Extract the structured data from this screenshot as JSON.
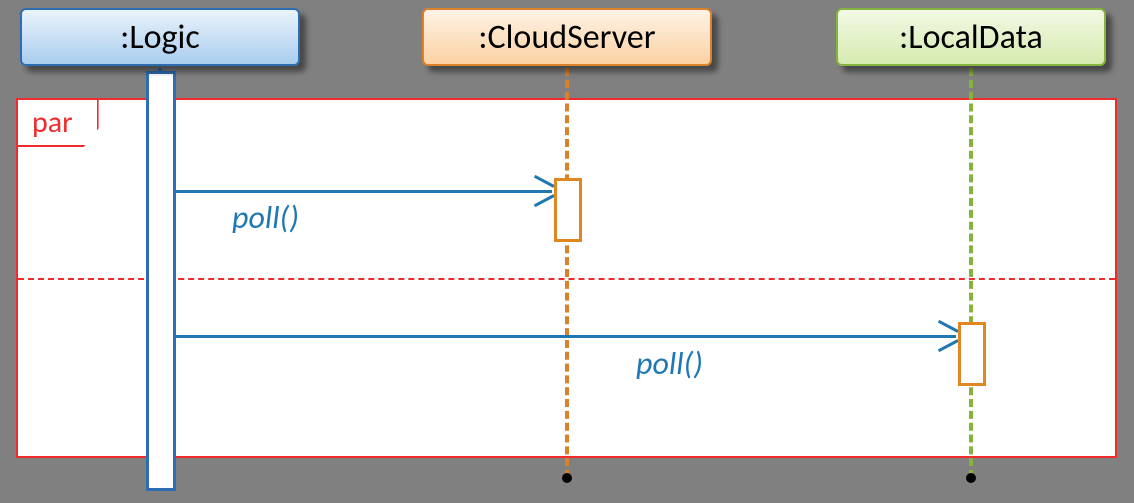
{
  "participants": {
    "logic": ":Logic",
    "cloud": ":CloudServer",
    "local": ":LocalData"
  },
  "fragment": {
    "operator": "par"
  },
  "messages": {
    "m1": "poll()",
    "m2": "poll()"
  },
  "chart_data": {
    "type": "uml-sequence",
    "participants": [
      {
        "id": "logic",
        "label": ":Logic"
      },
      {
        "id": "cloud",
        "label": ":CloudServer"
      },
      {
        "id": "local",
        "label": ":LocalData"
      }
    ],
    "fragments": [
      {
        "operator": "par",
        "operands": [
          {
            "messages": [
              {
                "from": "logic",
                "to": "cloud",
                "label": "poll()",
                "async": true
              }
            ]
          },
          {
            "messages": [
              {
                "from": "logic",
                "to": "local",
                "label": "poll()",
                "async": true
              }
            ]
          }
        ]
      }
    ]
  }
}
